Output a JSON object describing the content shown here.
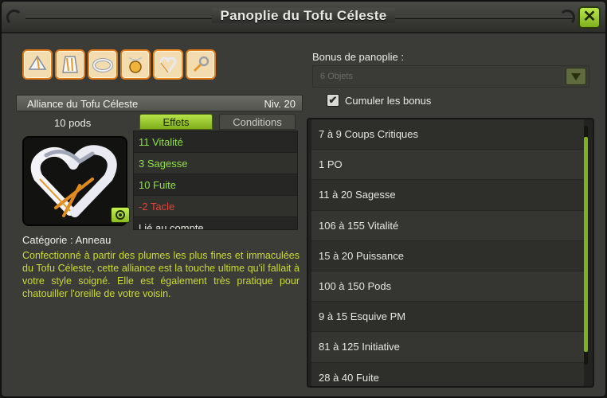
{
  "window": {
    "title": "Panoplie du Tofu Céleste",
    "close_label": "✕"
  },
  "set_items": [
    {
      "icon": "hat-icon"
    },
    {
      "icon": "cape-icon"
    },
    {
      "icon": "belt-icon"
    },
    {
      "icon": "amulet-icon"
    },
    {
      "icon": "ring-icon"
    },
    {
      "icon": "boots-icon"
    }
  ],
  "item": {
    "name": "Alliance du Tofu Céleste",
    "level": "Niv. 20",
    "pods": "10 pods",
    "category": "Catégorie : Anneau",
    "description": "Confectionné à partir des plumes les plus fines et immaculées du Tofu Céleste, cette alliance est la touche ultime qu'il fallait à votre style soigné. Elle est également très pratique pour chatouiller l'oreille de votre voisin."
  },
  "tabs": {
    "effects": "Effets",
    "conditions": "Conditions"
  },
  "effects": [
    {
      "text": "11 Vitalité",
      "color": "#8fe044"
    },
    {
      "text": "3 Sagesse",
      "color": "#8fe044"
    },
    {
      "text": "10 Fuite",
      "color": "#8fe044"
    },
    {
      "text": "-2 Tacle",
      "color": "#e3443a"
    },
    {
      "text": "Lié au compte",
      "color": "#e6e6e0"
    }
  ],
  "bonus": {
    "label": "Bonus de panoplie :",
    "dropdown_value": "6 Objets",
    "cumulate_label": "Cumuler les bonus",
    "cumulate_checked": "✔",
    "rows": [
      "7 à 9 Coups Critiques",
      "1 PO",
      "11 à 20 Sagesse",
      "106 à 155 Vitalité",
      "15 à 20 Puissance",
      "100 à 150 Pods",
      "9 à 15 Esquive PM",
      "81 à 125 Initiative",
      "28 à 40 Fuite"
    ]
  },
  "colors": {
    "accent": "#8fc42a",
    "effect_positive": "#8fe044",
    "effect_negative": "#e3443a",
    "description": "#c9dc32"
  }
}
